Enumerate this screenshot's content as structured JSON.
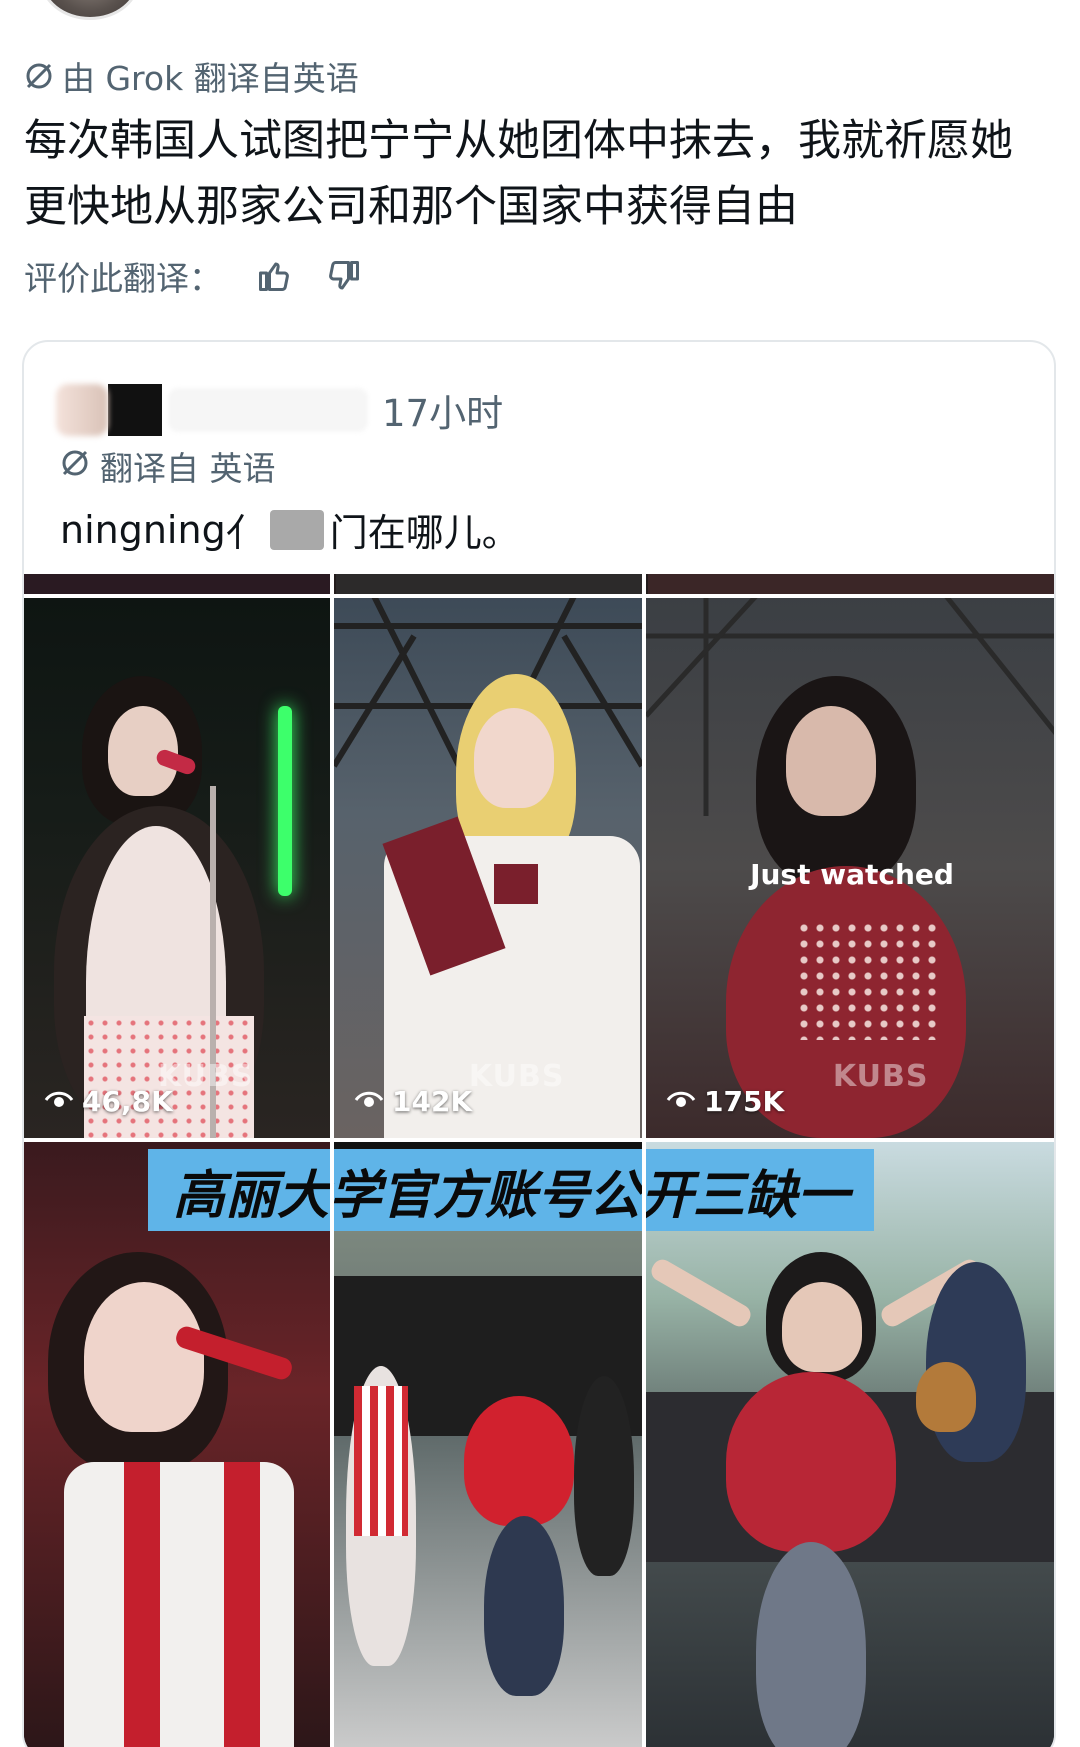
{
  "top_post": {
    "translated_by": "由 Grok 翻译自英语",
    "text": "每次韩国人试图把宁宁从她团体中抹去，我就祈愿她更快地从那家公司和那个国家中获得自由",
    "rate_label": "评价此翻译："
  },
  "quote": {
    "time": "17小时",
    "translated_from": "翻译自 英语",
    "text_start": "ningning",
    "text_mid": "亻",
    "text_end": "门在哪儿。",
    "media": {
      "tiles": [
        {
          "views": "46,8K",
          "watermark": "KUBS"
        },
        {
          "views": "142K",
          "watermark": "KUBS"
        },
        {
          "views": "175K",
          "watermark": "KUBS",
          "overlay": "Just watched"
        }
      ],
      "banner": "高丽大学官方账号公开三缺一"
    }
  },
  "colors": {
    "text": "#0f1419",
    "muted": "#536471",
    "banner": "#5fb4e8",
    "border": "#e3e7ea"
  },
  "icons": [
    "slash-icon",
    "thumbs-up-icon",
    "thumbs-down-icon",
    "eye-icon"
  ]
}
